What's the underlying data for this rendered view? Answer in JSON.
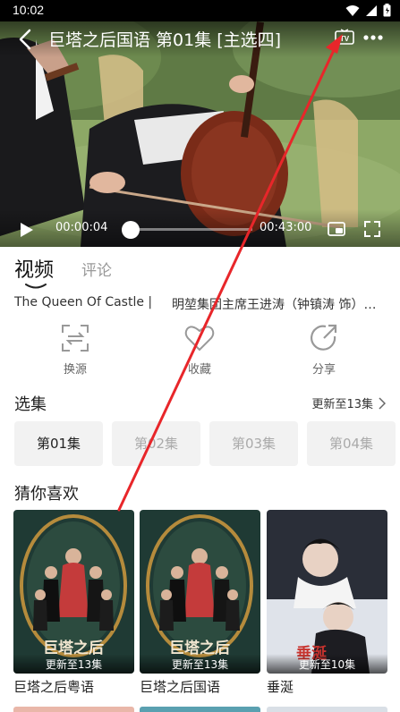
{
  "status_bar": {
    "time": "10:02"
  },
  "player": {
    "title": "巨塔之后国语 第01集 [主选四]",
    "tv_label": "TV",
    "current_time": "00:00:04",
    "total_time": "00:43:00",
    "progress": 0.0016
  },
  "tabs": [
    {
      "label": "视频",
      "active": true
    },
    {
      "label": "评论",
      "active": false
    }
  ],
  "info": {
    "theme": "The Queen Of Castle |",
    "cast": "明堃集团主席王进涛（钟镇涛 饰）…"
  },
  "actions": [
    {
      "label": "换源",
      "icon": "swap-source-icon"
    },
    {
      "label": "收藏",
      "icon": "heart-icon"
    },
    {
      "label": "分享",
      "icon": "share-icon"
    }
  ],
  "episodes_section": {
    "title": "选集",
    "updated": "更新至13集",
    "items": [
      "第01集",
      "第02集",
      "第03集",
      "第04集"
    ],
    "selected_index": 0
  },
  "recommendations": {
    "title": "猜你喜欢",
    "items": [
      {
        "name": "巨塔之后粤语",
        "badge": "更新至13集",
        "poster_text": "巨塔之后"
      },
      {
        "name": "巨塔之后国语",
        "badge": "更新至13集",
        "poster_text": "巨塔之后"
      },
      {
        "name": "垂涎",
        "badge": "更新至10集",
        "poster_text": "垂涎"
      }
    ]
  },
  "colors": {
    "annotation_arrow": "#e8262a",
    "tab_indicator": "#222222",
    "episode_bg": "#f2f2f2"
  }
}
